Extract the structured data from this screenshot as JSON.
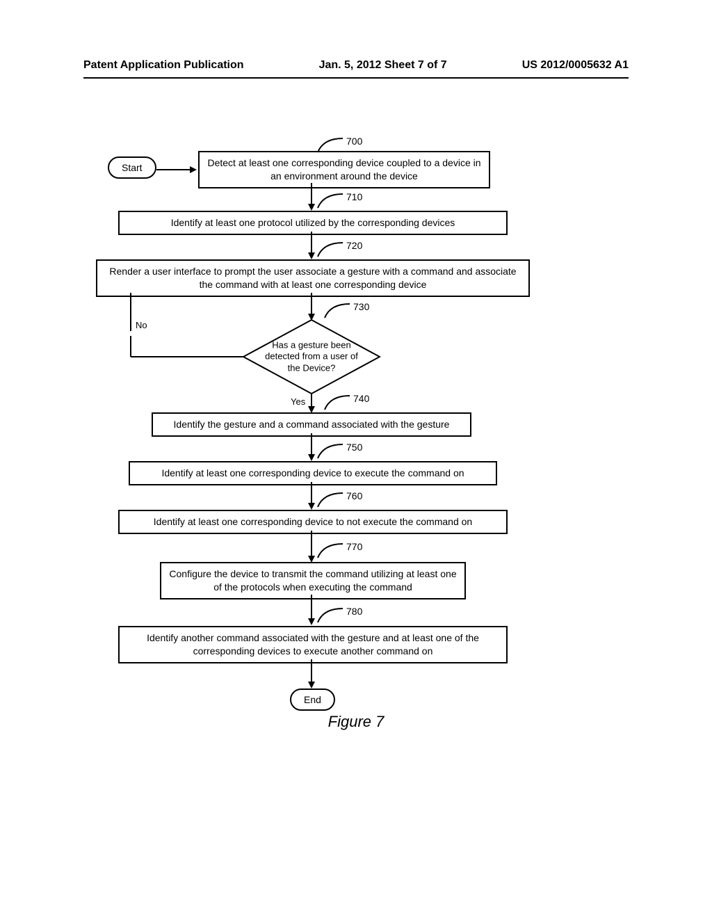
{
  "header": {
    "left": "Patent Application Publication",
    "center": "Jan. 5, 2012   Sheet 7 of 7",
    "right": "US 2012/0005632 A1"
  },
  "flowchart": {
    "start": "Start",
    "end": "End",
    "figure_label": "Figure 7",
    "decision_no": "No",
    "decision_yes": "Yes",
    "steps": [
      {
        "ref": "700",
        "text": "Detect at least one corresponding device coupled to a device in an environment around the device"
      },
      {
        "ref": "710",
        "text": "Identify at least one protocol utilized by the corresponding devices"
      },
      {
        "ref": "720",
        "text": "Render a user interface to prompt the user associate a gesture with a command and associate the command with at least one corresponding device"
      },
      {
        "ref": "730",
        "text": "Has a gesture been detected from a user of the Device?"
      },
      {
        "ref": "740",
        "text": "Identify the gesture and a command associated with the gesture"
      },
      {
        "ref": "750",
        "text": "Identify at least one corresponding device to execute the command on"
      },
      {
        "ref": "760",
        "text": "Identify at least one corresponding device to not execute the command on"
      },
      {
        "ref": "770",
        "text": "Configure the device to transmit the command utilizing at least one of the protocols when executing the command"
      },
      {
        "ref": "780",
        "text": "Identify another command associated with the gesture and at least one of the corresponding devices to execute another command on"
      }
    ]
  }
}
